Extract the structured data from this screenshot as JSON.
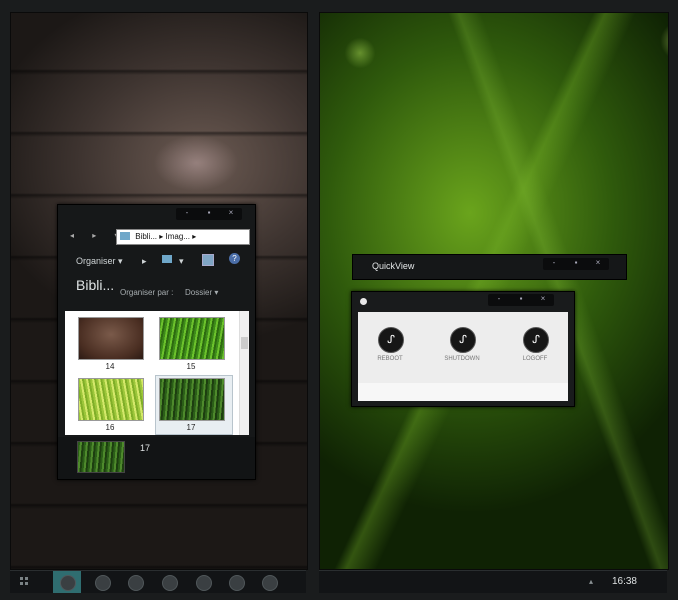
{
  "explorer": {
    "window_controls": [
      "-",
      "▪",
      "×"
    ],
    "nav_arrows": "◂ ▸ ▾",
    "address_crumbs": [
      "Bibli...",
      "Imag...",
      "▸"
    ],
    "toolbar": {
      "organise": "Organiser",
      "views_arrow": "▾",
      "help": "?"
    },
    "library_title": "Bibli...",
    "arrange_by_label": "Organiser par :",
    "arrange_by_value": "Dossier",
    "thumbnails": [
      {
        "caption": "14"
      },
      {
        "caption": "15"
      },
      {
        "caption": "16"
      },
      {
        "caption": "17"
      }
    ],
    "details": {
      "name": "17"
    }
  },
  "quickview": {
    "title": "QuickView",
    "title_controls": [
      "-",
      "▪",
      "×"
    ],
    "panel_controls": [
      "-",
      "▪",
      "×"
    ],
    "buttons": [
      {
        "label": "REBOOT",
        "icon": "power-icon"
      },
      {
        "label": "SHUTDOWN",
        "icon": "power-icon"
      },
      {
        "label": "LOGOFF",
        "icon": "power-icon"
      }
    ]
  },
  "taskbar_right": {
    "clock": "16:38",
    "tray_arrow": "▴"
  },
  "colors": {
    "taskbar": "#121416",
    "active_task": "#2f6d70",
    "qv_button": "#161616"
  }
}
